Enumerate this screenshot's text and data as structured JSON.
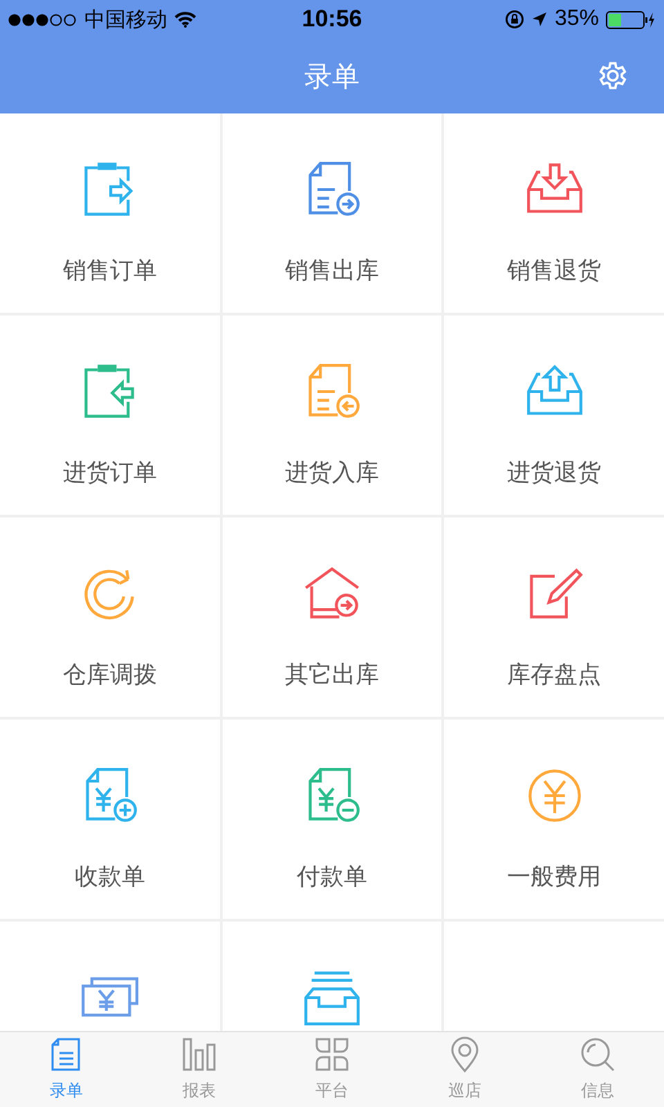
{
  "status_bar": {
    "carrier": "中国移动",
    "time": "10:56",
    "battery": "35%"
  },
  "nav_bar": {
    "title": "录单"
  },
  "tiles": [
    {
      "label": "销售订单",
      "kind": "clipboard-out",
      "color": "#2fb3ec"
    },
    {
      "label": "销售出库",
      "kind": "doc-out",
      "color": "#4f8fe6"
    },
    {
      "label": "销售退货",
      "kind": "tray-in",
      "color": "#f2545b"
    },
    {
      "label": "进货订单",
      "kind": "clipboard-in",
      "color": "#2dbd8d"
    },
    {
      "label": "进货入库",
      "kind": "doc-in",
      "color": "#ffa83c"
    },
    {
      "label": "进货退货",
      "kind": "tray-out",
      "color": "#2fb3ec"
    },
    {
      "label": "仓库调拨",
      "kind": "refresh",
      "color": "#ffa83c"
    },
    {
      "label": "其它出库",
      "kind": "house-out",
      "color": "#f2545b"
    },
    {
      "label": "库存盘点",
      "kind": "edit",
      "color": "#f2545b"
    },
    {
      "label": "收款单",
      "kind": "doc-plus",
      "color": "#2fb3ec"
    },
    {
      "label": "付款单",
      "kind": "doc-minus",
      "color": "#2dbd8d"
    },
    {
      "label": "一般费用",
      "kind": "coin",
      "color": "#ffa83c"
    },
    {
      "kind": "bills",
      "color": "#6c9de8"
    },
    {
      "kind": "stack",
      "color": "#2fb3ec"
    }
  ],
  "tabs": [
    {
      "label": "录单",
      "kind": "doc",
      "selected": true
    },
    {
      "label": "报表",
      "kind": "bars",
      "selected": false
    },
    {
      "label": "平台",
      "kind": "grid",
      "selected": false
    },
    {
      "label": "巡店",
      "kind": "pin",
      "selected": false
    },
    {
      "label": "信息",
      "kind": "search",
      "selected": false
    }
  ]
}
